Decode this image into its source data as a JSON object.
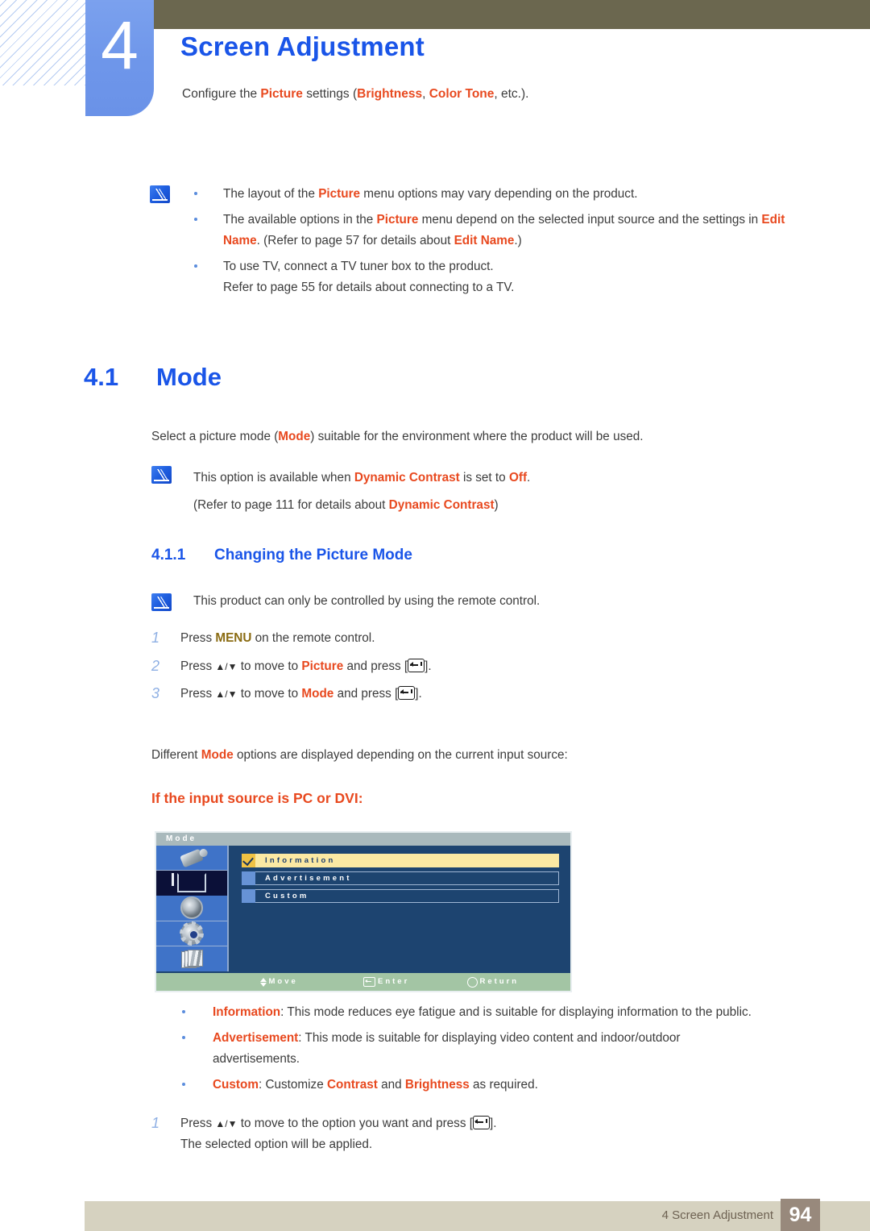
{
  "header": {
    "chapter_number": "4",
    "chapter_title": "Screen Adjustment",
    "subtitle_parts": {
      "p1": "Configure the ",
      "k1": "Picture",
      "p2": " settings (",
      "k2": "Brightness",
      "p3": ", ",
      "k3": "Color Tone",
      "p4": ", etc.)."
    }
  },
  "top_notes": {
    "icon": "note-pen-icon",
    "items": [
      {
        "parts": [
          {
            "t": "The layout of the ",
            "hl": false
          },
          {
            "t": "Picture",
            "hl": true
          },
          {
            "t": " menu options may vary depending on the product.",
            "hl": false
          }
        ]
      },
      {
        "parts": [
          {
            "t": "The available options in the ",
            "hl": false
          },
          {
            "t": "Picture",
            "hl": true
          },
          {
            "t": " menu depend on the selected input source and the settings in ",
            "hl": false
          },
          {
            "t": "Edit Name",
            "hl": true
          },
          {
            "t": ". (Refer to page 57 for details about ",
            "hl": false
          },
          {
            "t": "Edit Name",
            "hl": true
          },
          {
            "t": ".)",
            "hl": false
          }
        ]
      },
      {
        "parts": [
          {
            "t": "To use TV, connect a TV tuner box to the product.",
            "hl": false
          }
        ],
        "continuation": "Refer to page 55 for details about connecting to a TV."
      }
    ]
  },
  "section_41": {
    "number": "4.1",
    "title": "Mode",
    "intro_parts": [
      {
        "t": "Select a picture mode (",
        "hl": false
      },
      {
        "t": "Mode",
        "hl": true
      },
      {
        "t": ") suitable for the environment where the product will be used.",
        "hl": false
      }
    ],
    "note": {
      "icon": "note-pen-icon",
      "line1_parts": [
        {
          "t": "This option is available when ",
          "hl": false
        },
        {
          "t": "Dynamic Contrast",
          "hl": true
        },
        {
          "t": " is set to ",
          "hl": false
        },
        {
          "t": "Off",
          "hl": true
        },
        {
          "t": ".",
          "hl": false
        }
      ],
      "line2_parts": [
        {
          "t": "(Refer to page 111 for details about ",
          "hl": false
        },
        {
          "t": "Dynamic Contrast",
          "hl": true
        },
        {
          "t": ")",
          "hl": false
        }
      ]
    }
  },
  "section_411": {
    "number": "4.1.1",
    "title": "Changing the Picture Mode",
    "note": {
      "icon": "note-pen-icon",
      "text": "This product can only be controlled by using the remote control."
    },
    "steps": [
      {
        "num": "1",
        "parts": [
          {
            "t": "Press ",
            "hl": false
          },
          {
            "t": "MENU",
            "hl": "olive"
          },
          {
            "t": " on the remote control.",
            "hl": false
          }
        ]
      },
      {
        "num": "2",
        "parts": [
          {
            "t": "Press ",
            "hl": false
          },
          {
            "t": "▲/▼",
            "hl": "arrow"
          },
          {
            "t": " to move to ",
            "hl": false
          },
          {
            "t": "Picture",
            "hl": true
          },
          {
            "t": " and press [",
            "hl": false
          },
          {
            "t": "ENTERKEY",
            "hl": "key"
          },
          {
            "t": "].",
            "hl": false
          }
        ]
      },
      {
        "num": "3",
        "parts": [
          {
            "t": "Press ",
            "hl": false
          },
          {
            "t": "▲/▼",
            "hl": "arrow"
          },
          {
            "t": " to move to ",
            "hl": false
          },
          {
            "t": "Mode",
            "hl": true
          },
          {
            "t": " and press [",
            "hl": false
          },
          {
            "t": "ENTERKEY",
            "hl": "key"
          },
          {
            "t": "].",
            "hl": false
          }
        ]
      }
    ],
    "different_modes_parts": [
      {
        "t": "Different ",
        "hl": false
      },
      {
        "t": "Mode",
        "hl": true
      },
      {
        "t": " options are displayed depending on the current input source:",
        "hl": false
      }
    ],
    "input_source_heading": "If the input source is PC or DVI:"
  },
  "osd": {
    "title": "Mode",
    "sidebar_icons": [
      {
        "name": "input-source-icon",
        "selected": false
      },
      {
        "name": "picture-icon",
        "selected": true
      },
      {
        "name": "sound-speaker-icon",
        "selected": false
      },
      {
        "name": "setup-gear-icon",
        "selected": false
      },
      {
        "name": "multi-control-icon",
        "selected": false
      }
    ],
    "rows": [
      {
        "label": "Information",
        "active": true,
        "checked": true
      },
      {
        "label": "Advertisement",
        "active": false,
        "checked": false
      },
      {
        "label": "Custom",
        "active": false,
        "checked": false
      }
    ],
    "footer": [
      {
        "icon": "updown-arrow-icon",
        "label": "Move"
      },
      {
        "icon": "enter-key-icon",
        "label": "Enter"
      },
      {
        "icon": "return-circle-icon",
        "label": "Return"
      }
    ],
    "colors": {
      "background": "#1d4470",
      "sidebar": "#3f73c8",
      "selected_icon_bg": "#0b1038",
      "highlight_row": "#fbe9a3",
      "chip": "#6793d6",
      "chip_active": "#f0c244",
      "title_bar": "#a9b9bc",
      "footer_bar": "#a3c5a4"
    }
  },
  "mode_descriptions": [
    {
      "parts": [
        {
          "t": "Information",
          "hl": true
        },
        {
          "t": ": This mode reduces eye fatigue and is suitable for displaying information to the public.",
          "hl": false
        }
      ]
    },
    {
      "parts": [
        {
          "t": "Advertisement",
          "hl": true
        },
        {
          "t": ": This mode is suitable for displaying video content and indoor/outdoor",
          "hl": false
        }
      ],
      "continuation": "advertisements."
    },
    {
      "parts": [
        {
          "t": "Custom",
          "hl": true
        },
        {
          "t": ": Customize ",
          "hl": false
        },
        {
          "t": "Contrast",
          "hl": true
        },
        {
          "t": " and ",
          "hl": false
        },
        {
          "t": "Brightness",
          "hl": true
        },
        {
          "t": " as required.",
          "hl": false
        }
      ]
    }
  ],
  "final_step": {
    "num": "1",
    "parts": [
      {
        "t": "Press ",
        "hl": false
      },
      {
        "t": "▲/▼",
        "hl": "arrow"
      },
      {
        "t": " to move to the option you want and press [",
        "hl": false
      },
      {
        "t": "ENTERKEY",
        "hl": "key"
      },
      {
        "t": "].",
        "hl": false
      }
    ],
    "continuation": "The selected option will be applied."
  },
  "footer": {
    "label": "4 Screen Adjustment",
    "page": "94"
  }
}
